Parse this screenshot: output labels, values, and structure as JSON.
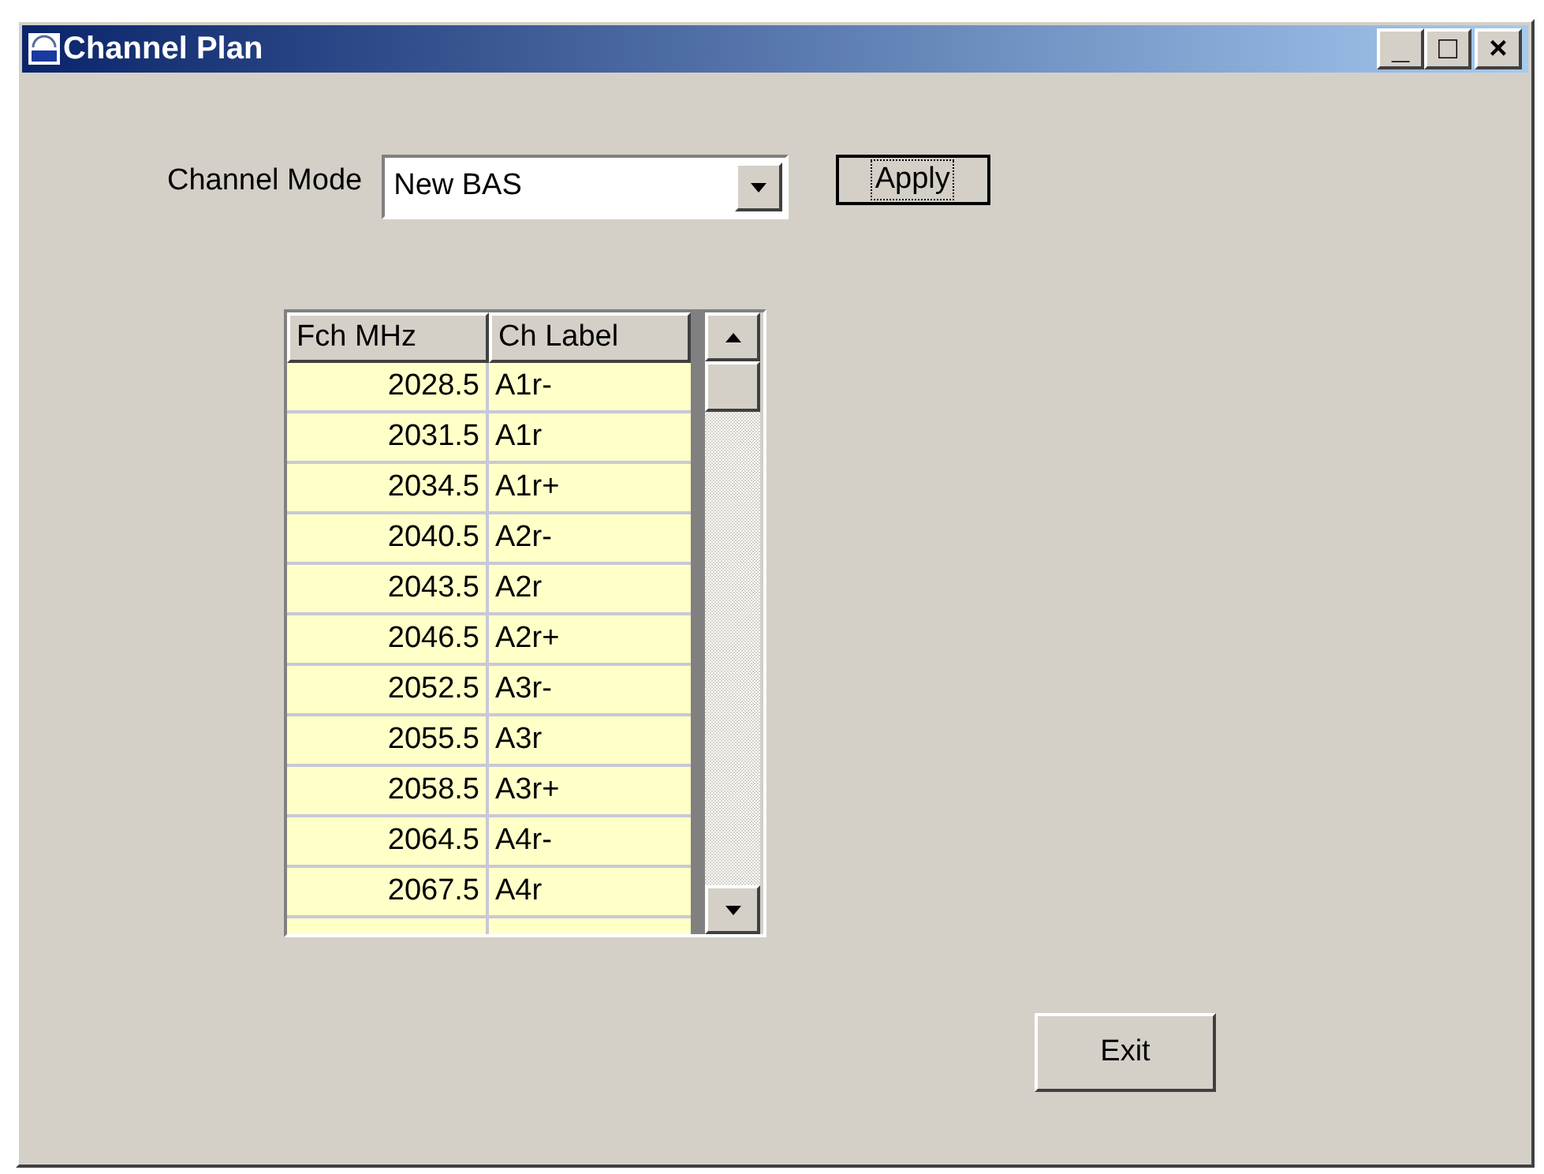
{
  "window": {
    "title": "Channel Plan",
    "controls": [
      "_",
      "□",
      "×"
    ]
  },
  "channel_mode": {
    "label": "Channel Mode",
    "value": "New BAS"
  },
  "apply_button": "Apply",
  "table": {
    "columns": [
      "Fch MHz",
      "Ch Label"
    ],
    "rows": [
      [
        "2028.5",
        "A1r-"
      ],
      [
        "2031.5",
        "A1r"
      ],
      [
        "2034.5",
        "A1r+"
      ],
      [
        "2040.5",
        "A2r-"
      ],
      [
        "2043.5",
        "A2r"
      ],
      [
        "2046.5",
        "A2r+"
      ],
      [
        "2052.5",
        "A3r-"
      ],
      [
        "2055.5",
        "A3r"
      ],
      [
        "2058.5",
        "A3r+"
      ],
      [
        "2064.5",
        "A4r-"
      ],
      [
        "2067.5",
        "A4r"
      ]
    ]
  },
  "exit_button": "Exit"
}
